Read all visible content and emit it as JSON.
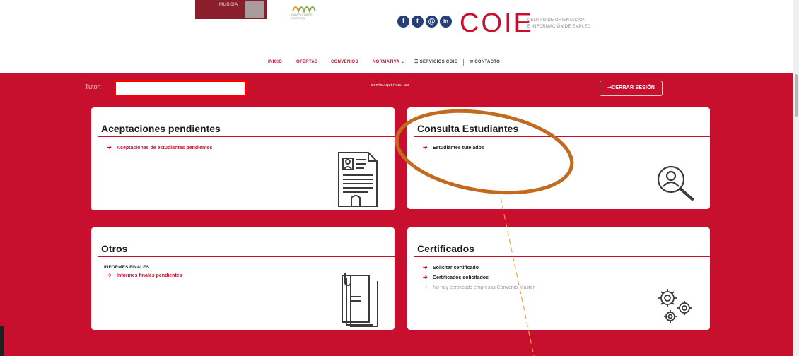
{
  "header": {
    "umu_logo_text": "MURCIA",
    "cmn_logo_text": "cmn",
    "cmn_logo_sub": "CAMPUS MARE NOSTRUM",
    "social_icons": [
      "facebook-icon",
      "twitter-icon",
      "email-icon",
      "linkedin-icon"
    ],
    "social_glyphs": [
      "f",
      "t",
      "@",
      "in"
    ],
    "coie_logo": "COIE",
    "coie_tagline_1": "CENTRO DE ORIENTACIÓN",
    "coie_tagline_2": "E INFORMACIÓN DE EMPLEO"
  },
  "nav": {
    "items": [
      {
        "label": "INICIO"
      },
      {
        "label": "OFERTAS"
      },
      {
        "label": "CONVENIOS"
      },
      {
        "label": "NORMATIVA ⌄"
      },
      {
        "label": "☰ SERVICIOS COIE"
      },
      {
        "label": "✉ CONTACTO"
      }
    ]
  },
  "user_bar": {
    "tutor_label": "Tutor: ",
    "tutor_name": "",
    "breadcrumb": "ESTÁS AQUÍ /Tutor UM",
    "logout_label": "⇥CERRAR SESIÓN"
  },
  "cards": {
    "aceptaciones": {
      "title": "Aceptaciones pendientes",
      "links": [
        "Aceptaciones de estudiantes pendientes"
      ]
    },
    "consulta": {
      "title": "Consulta Estudiantes",
      "links": [
        "Estudiantes tutelados"
      ]
    },
    "otros": {
      "title": "Otros",
      "heading": "INFORMES FINALES",
      "links": [
        "Informes finales pendientes"
      ]
    },
    "certificados": {
      "title": "Certificados",
      "links": [
        "Solicitar certificado",
        "Certificados solicitados"
      ],
      "notice": "No hay certificado empresas Convenio-Master"
    }
  },
  "colors": {
    "brand_red": "#c8102e",
    "annotation_orange": "#c26a1e",
    "annotation_line": "#f2a33a",
    "social_blue": "#253f7a"
  }
}
